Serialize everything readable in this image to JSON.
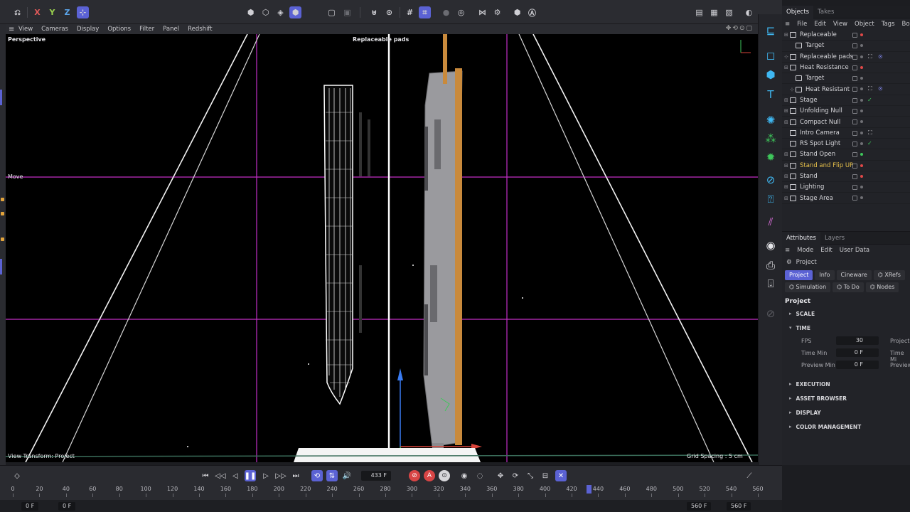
{
  "toolbar": {
    "axes": [
      "X",
      "Y",
      "Z"
    ]
  },
  "viewport": {
    "menu": [
      "View",
      "Cameras",
      "Display",
      "Options",
      "Filter",
      "Panel",
      "Redshift"
    ],
    "camera_label": "Perspective",
    "object_label": "Replaceable pads",
    "tool_label": "Move",
    "transform_label": "View Transform: Project",
    "grid_spacing": "Grid Spacing : 5 cm"
  },
  "objects_panel": {
    "tabs": [
      "Objects",
      "Takes"
    ],
    "menu": [
      "File",
      "Edit",
      "View",
      "Object",
      "Tags",
      "Book"
    ],
    "items": [
      {
        "name": "Replaceable",
        "dot": "#e04848"
      },
      {
        "name": "Target",
        "dot": "#707075"
      },
      {
        "name": "Replaceable pads",
        "dot": "#707075"
      },
      {
        "name": "Heat Resistance",
        "dot": "#e04848"
      },
      {
        "name": "Target",
        "dot": "#707075"
      },
      {
        "name": "Heat Resistant",
        "dot": "#707075"
      },
      {
        "name": "Stage",
        "dot": "#707075"
      },
      {
        "name": "Unfolding Null",
        "dot": "#707075"
      },
      {
        "name": "Compact Null",
        "dot": "#707075"
      },
      {
        "name": "Intro Camera",
        "dot": "#707075"
      },
      {
        "name": "RS Spot Light",
        "dot": "#707075"
      },
      {
        "name": "Stand Open",
        "dot": "#3ec75b"
      },
      {
        "name": "Stand and Flip UP",
        "dot": "#e04848",
        "highlight": true
      },
      {
        "name": "Stand",
        "dot": "#e04848"
      },
      {
        "name": "Lighting",
        "dot": "#707075"
      },
      {
        "name": "Stage Area",
        "dot": "#707075"
      }
    ]
  },
  "attributes_panel": {
    "tabs": [
      "Attributes",
      "Layers"
    ],
    "menu": [
      "Mode",
      "Edit",
      "User Data"
    ],
    "breadcrumb": "Project",
    "sub_tabs": [
      "Project",
      "Info",
      "Cineware",
      "XRefs",
      "Simulation",
      "To Do",
      "Nodes"
    ],
    "title": "Project",
    "sections": {
      "scale": "SCALE",
      "time": "TIME",
      "execution": "EXECUTION",
      "asset_browser": "ASSET BROWSER",
      "display": "DISPLAY",
      "color_management": "COLOR MANAGEMENT"
    },
    "fields": [
      {
        "label": "FPS",
        "value": "30",
        "right_label": "Project"
      },
      {
        "label": "Time Min",
        "value": "0 F",
        "right_label": "Time Mi"
      },
      {
        "label": "Preview Min",
        "value": "0 F",
        "right_label": "Preview"
      }
    ]
  },
  "timeline": {
    "current_frame": "433 F",
    "playhead_frame": 433,
    "ruler_max": 560,
    "ruler_ticks": [
      0,
      20,
      40,
      60,
      80,
      100,
      120,
      140,
      160,
      180,
      200,
      220,
      240,
      260,
      280,
      300,
      320,
      340,
      360,
      380,
      400,
      420,
      440,
      460,
      480,
      500,
      520,
      540,
      560
    ],
    "start_field": "0 F",
    "min_field": "0 F",
    "end_field_1": "560 F",
    "end_field_2": "560 F"
  },
  "colors": {
    "accent": "#5b62d4",
    "magenta_guides": "#c22fc7",
    "record_red": "#d84545",
    "highlight_text": "#e8c14a",
    "green_dot": "#3ec75b"
  }
}
